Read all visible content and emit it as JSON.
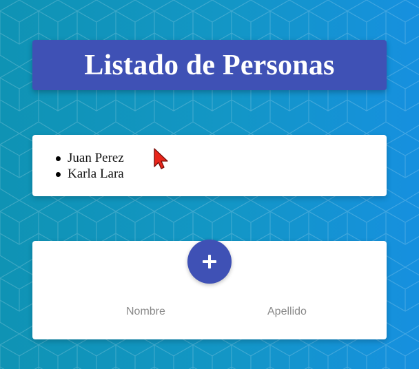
{
  "header": {
    "title": "Listado de Personas"
  },
  "personas": [
    {
      "name": "Juan Perez"
    },
    {
      "name": "Karla Lara"
    }
  ],
  "form": {
    "add_icon": "plus-icon",
    "nombre_label": "Nombre",
    "apellido_label": "Apellido"
  },
  "colors": {
    "primary": "#3f51b5",
    "background_start": "#0f93b4",
    "background_end": "#1690df",
    "card": "#ffffff",
    "muted_text": "#8a8a8a"
  }
}
